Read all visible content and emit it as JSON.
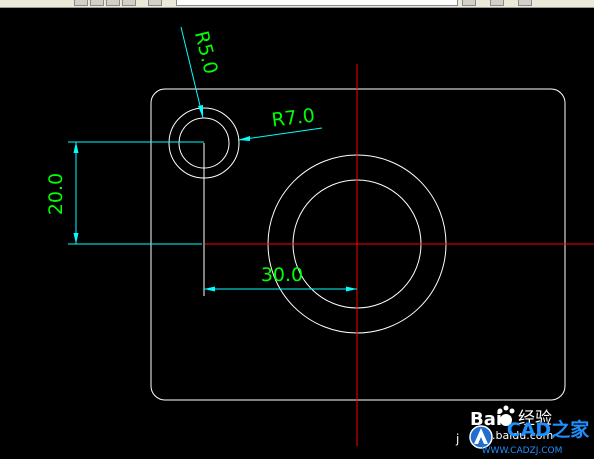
{
  "app": {
    "toolbar_buttons": [
      "blank",
      "blank",
      "blank",
      "blank",
      "blank",
      "blank"
    ]
  },
  "drawing": {
    "colors": {
      "background": "#000000",
      "outline": "#ffffff",
      "dimension_line": "#00ffff",
      "dimension_text": "#00ff00",
      "center_line": "#ff0000"
    },
    "dimensions": {
      "radius_small": "R5.0",
      "radius_large": "R7.0",
      "vertical": "20.0",
      "horizontal": "30.0"
    }
  },
  "watermark": {
    "brand_left": "Bai",
    "brand_right": "经验",
    "url_left": "j",
    "url_right": ".baidu.com",
    "site_name": "CAD之家",
    "site_url": "WWW.CADZJ.COM"
  }
}
